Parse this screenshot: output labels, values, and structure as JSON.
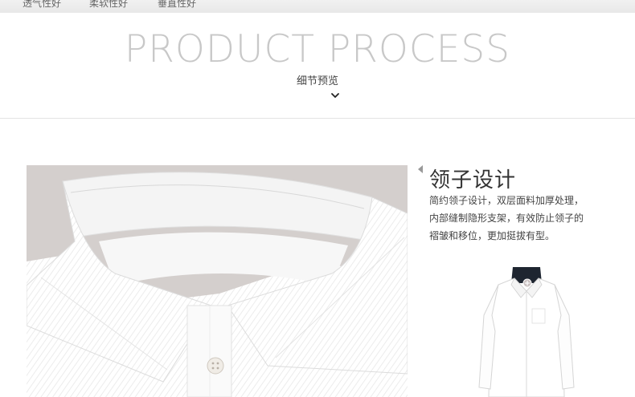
{
  "top_strip": {
    "labels": [
      "透气性好",
      "柔软性好",
      "垂直性好"
    ]
  },
  "header": {
    "title": "PRODUCT PROCESS",
    "subtitle": "细节预览",
    "chevron_icon": "chevron-down-icon"
  },
  "feature": {
    "title": "领子设计",
    "lines": [
      "简约领子设计，双层面料加厚处理，",
      "内部缝制隐形支架，有效防止领子的",
      "褶皱和移位，更加挺拔有型。"
    ]
  },
  "colors": {
    "title_gray": "#c8c8c8",
    "text_dark": "#333333",
    "divider": "#e3e3e3",
    "photo_bg": "#d6d1cf"
  }
}
